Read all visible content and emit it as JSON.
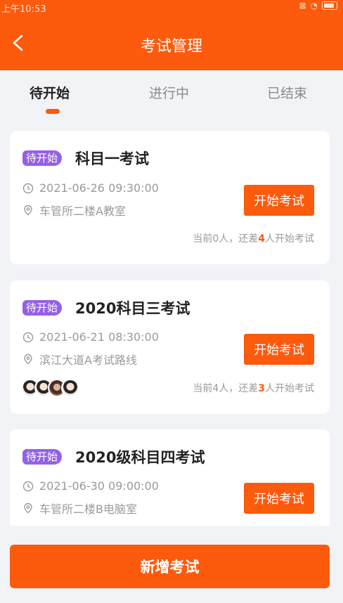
{
  "status_bar": {
    "time": "上午10:53"
  },
  "header": {
    "title": "考试管理"
  },
  "tabs": [
    {
      "label": "待开始",
      "active": true
    },
    {
      "label": "进行中",
      "active": false
    },
    {
      "label": "已结束",
      "active": false
    }
  ],
  "exams": [
    {
      "badge": "待开始",
      "title": "科目一考试",
      "datetime": "2021-06-26 09:30:00",
      "location": "车管所二楼A教室",
      "button": "开始考试",
      "count_prefix": "当前0人，还差",
      "count_need": "4",
      "count_suffix": "人开始考试"
    },
    {
      "badge": "待开始",
      "title": "2020科目三考试",
      "datetime": "2021-06-21 08:30:00",
      "location": "滨江大道A考试路线",
      "button": "开始考试",
      "count_prefix": "当前4人，还差",
      "count_need": "3",
      "count_suffix": "人开始考试",
      "avatars": 4
    },
    {
      "badge": "待开始",
      "title": "2020级科目四考试",
      "datetime": "2021-06-30 09:00:00",
      "location": "车管所二楼B电脑室",
      "button": "开始考试"
    }
  ],
  "footer": {
    "add_label": "新增考试"
  },
  "colors": {
    "accent": "#fc5a0c",
    "badge": "#9461e6",
    "background": "#f2f3f7"
  }
}
